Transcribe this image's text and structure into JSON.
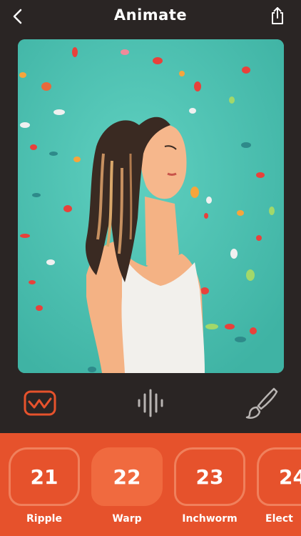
{
  "header": {
    "title": "Animate",
    "back_icon": "chevron-left-icon",
    "share_icon": "share-icon"
  },
  "canvas": {
    "description_icon": "animated-portrait-image",
    "background_color": "#4fc4b4"
  },
  "tools": [
    {
      "name": "wave-tool",
      "icon": "wave-icon",
      "active": true
    },
    {
      "name": "audio-tool",
      "icon": "audio-bars-icon",
      "active": false
    },
    {
      "name": "brush-tool",
      "icon": "brush-icon",
      "active": false
    }
  ],
  "effects": [
    {
      "number": "21",
      "label": "Ripple",
      "selected": false
    },
    {
      "number": "22",
      "label": "Warp",
      "selected": true
    },
    {
      "number": "23",
      "label": "Inchworm",
      "selected": false
    },
    {
      "number": "24",
      "label": "Elect",
      "selected": false
    }
  ],
  "colors": {
    "background": "#2a2524",
    "accent": "#e6522c",
    "selected_card": "#f06a3f",
    "card_outline": "#f0805c"
  }
}
